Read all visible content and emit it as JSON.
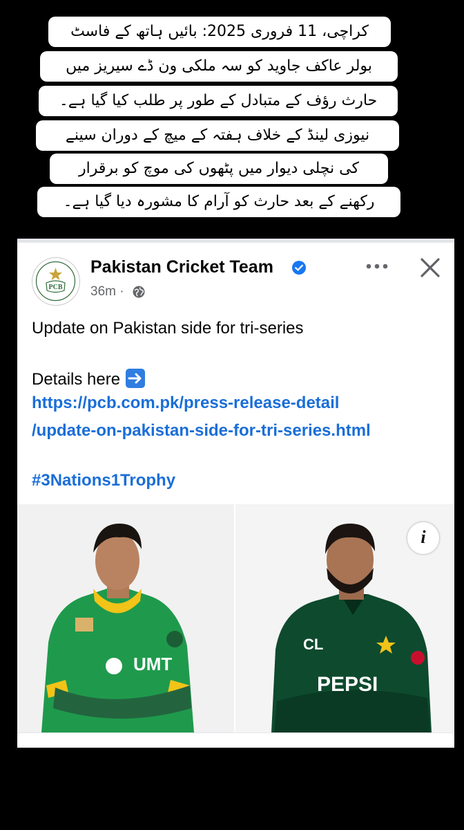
{
  "caption": {
    "lines": [
      "کراچی، 11 فروری 2025: بائیں ہاتھ کے فاسٹ",
      "بولر عاکف جاوید کو سہ ملکی ون ڈے سیریز میں",
      "حارث رؤف کے متبادل کے طور پر طلب کیا گیا ہے۔",
      "نیوزی لینڈ کے خلاف ہفتہ کے میچ کے دوران سینے",
      "کی نچلی دیوار میں پٹھوں کی موچ کو برقرار",
      "رکھنے کے بعد حارث کو آرام کا مشورہ دیا گیا ہے۔"
    ]
  },
  "post": {
    "page_name": "Pakistan Cricket Team",
    "avatar_text": "PCB",
    "time": "36m ·",
    "text": "Update on Pakistan side for tri-series",
    "details_label": "Details here",
    "link_line1": "https://pcb.com.pk/press-release-detail",
    "link_line2": "/update-on-pakistan-side-for-tri-series.html",
    "hashtag": "#3Nations1Trophy",
    "info_label": "i",
    "jersey_left": "UMT",
    "jersey_right_top": "CL",
    "jersey_right": "PEPSI"
  },
  "colors": {
    "link": "#1a6ed8",
    "verified": "#1877f2",
    "green_left": "#1f9a4c",
    "green_right": "#0e4a2e",
    "yellow": "#f2c318"
  },
  "icons": [
    "verified-badge-icon",
    "globe-icon",
    "more-options-icon",
    "close-icon",
    "arrow-right-icon",
    "info-icon"
  ]
}
